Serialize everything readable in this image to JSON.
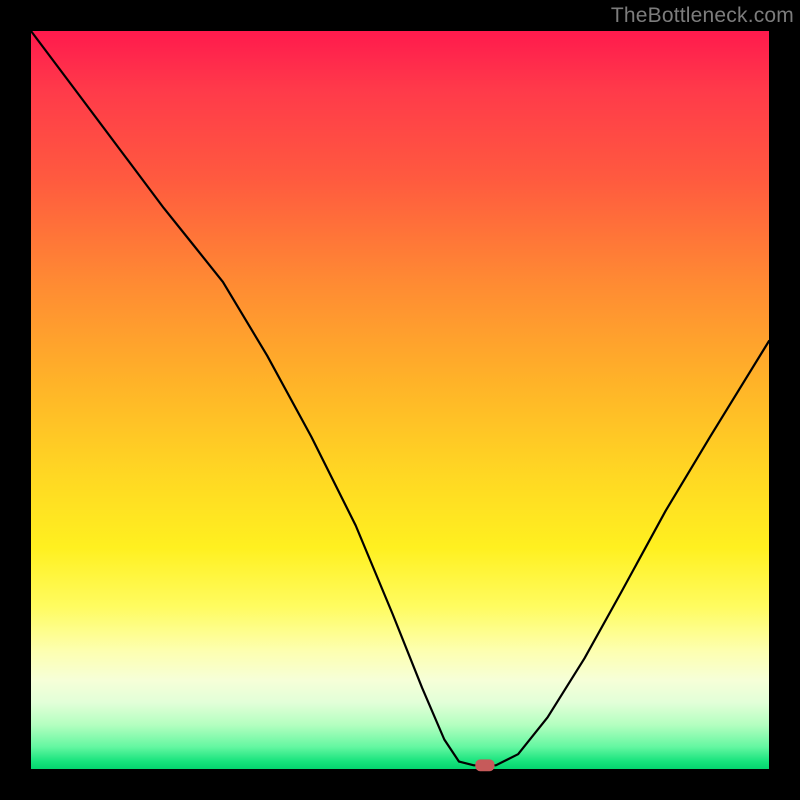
{
  "watermark": "TheBottleneck.com",
  "colors": {
    "background": "#000000",
    "curve": "#000000",
    "marker": "#c65a5a",
    "gradient_top": "#ff1a4d",
    "gradient_bottom": "#04d46e"
  },
  "chart_data": {
    "type": "line",
    "title": "",
    "xlabel": "",
    "ylabel": "",
    "xlim": [
      0,
      100
    ],
    "ylim": [
      0,
      100
    ],
    "grid": false,
    "legend": false,
    "comment": "No axes or tick labels are rendered; values are estimated from pixel positions within the 738×738 inner plot.",
    "series": [
      {
        "name": "bottleneck-curve",
        "x": [
          0,
          6,
          12,
          18,
          22,
          26,
          32,
          38,
          44,
          49,
          53,
          56,
          58,
          60,
          63,
          66,
          70,
          75,
          80,
          86,
          92,
          100
        ],
        "y": [
          100,
          92,
          84,
          76,
          71,
          66,
          56,
          45,
          33,
          21,
          11,
          4,
          1,
          0.5,
          0.5,
          2,
          7,
          15,
          24,
          35,
          45,
          58
        ]
      }
    ],
    "marker": {
      "name": "detected-bottleneck-point",
      "x": 61.5,
      "y": 0.5,
      "shape": "rounded-rect",
      "width_pct": 2.6,
      "height_pct": 1.6
    }
  }
}
